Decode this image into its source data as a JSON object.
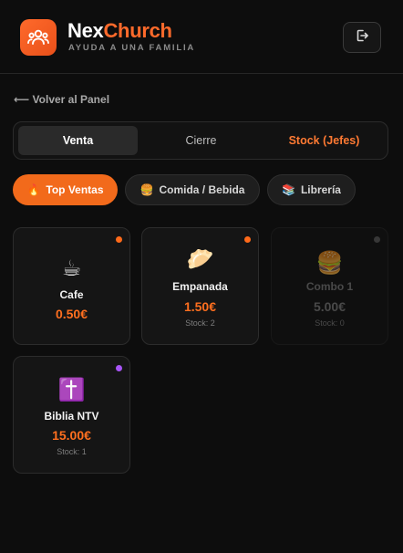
{
  "header": {
    "brand_part1": "Nex",
    "brand_part2": "Church",
    "tagline": "AYUDA A UNA FAMILIA",
    "logo_icon": "people-group-icon",
    "logout_icon": "logout-icon"
  },
  "nav": {
    "back_label": "⟵ Volver al Panel"
  },
  "tabs": [
    {
      "label": "Venta"
    },
    {
      "label": "Cierre"
    },
    {
      "label": "Stock (Jefes)"
    }
  ],
  "categories": [
    {
      "emoji": "🔥",
      "label": "Top Ventas"
    },
    {
      "emoji": "🍔",
      "label": "Comida / Bebida"
    },
    {
      "emoji": "📚",
      "label": "Librería"
    }
  ],
  "products": [
    {
      "emoji": "☕",
      "name": "Cafe",
      "price": "0.50€",
      "stock": "",
      "status_color": "#ff6a1a"
    },
    {
      "emoji": "🥟",
      "name": "Empanada",
      "price": "1.50€",
      "stock": "Stock: 2",
      "status_color": "#ff6a1a"
    },
    {
      "emoji": "🍔",
      "name": "Combo 1",
      "price": "5.00€",
      "stock": "Stock: 0",
      "status_color": "#5a5a5a"
    },
    {
      "emoji": "✝️",
      "name": "Biblia NTV",
      "price": "15.00€",
      "stock": "Stock: 1",
      "status_color": "#a855f7"
    }
  ],
  "colors": {
    "accent": "#f26a1b",
    "background": "#0d0d0d"
  }
}
